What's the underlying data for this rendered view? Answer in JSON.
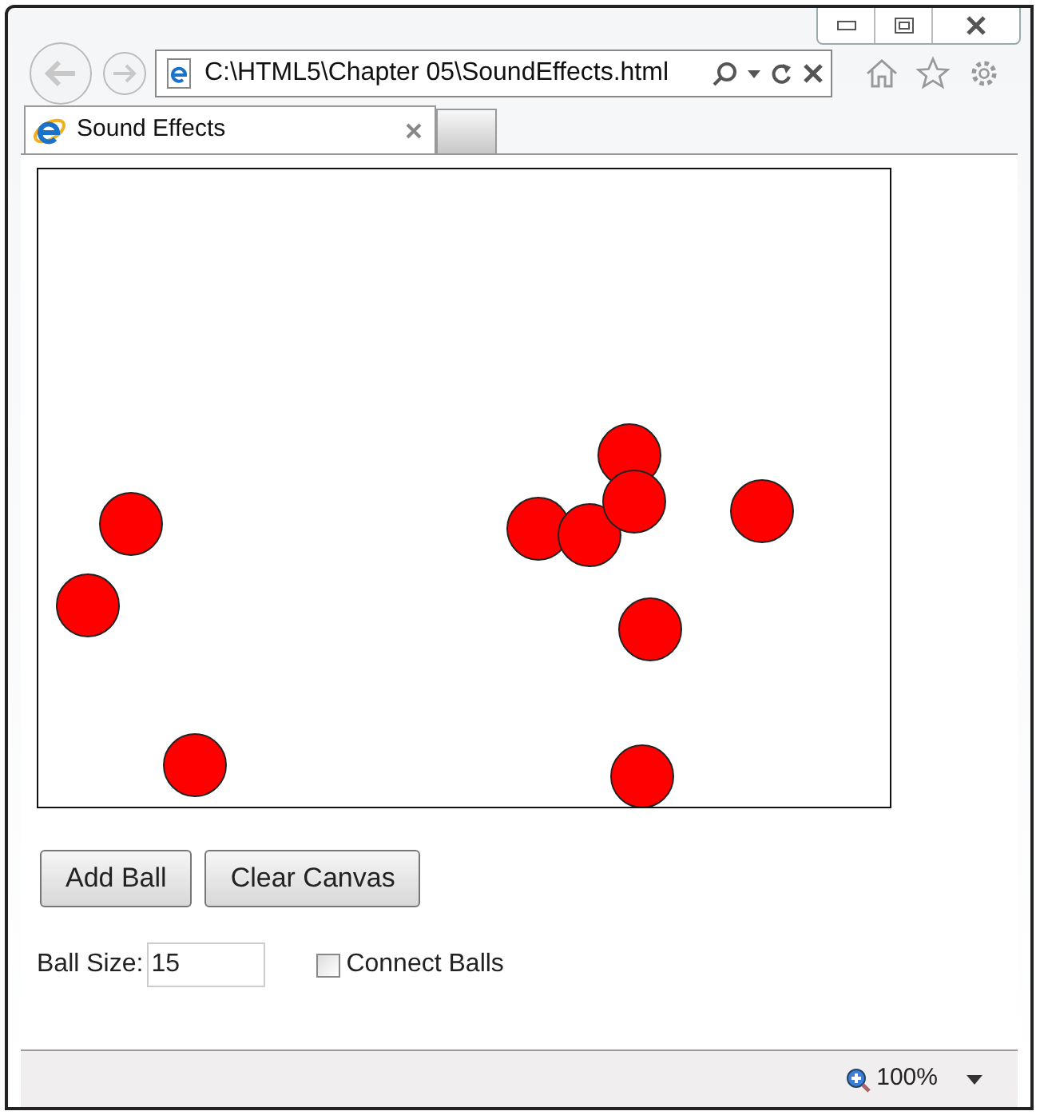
{
  "address_bar": {
    "url": "C:\\HTML5\\Chapter 05\\SoundEffects.html"
  },
  "tabs": [
    {
      "label": "Sound Effects",
      "selected": true
    }
  ],
  "buttons": [
    {
      "label": "Add Ball"
    },
    {
      "label": "Clear Canvas"
    }
  ],
  "ball_size": {
    "label": "Ball Size:",
    "value": "15"
  },
  "connect_balls": {
    "label": "Connect Balls",
    "checked": false
  },
  "status_bar": {
    "zoom": "100%"
  }
}
